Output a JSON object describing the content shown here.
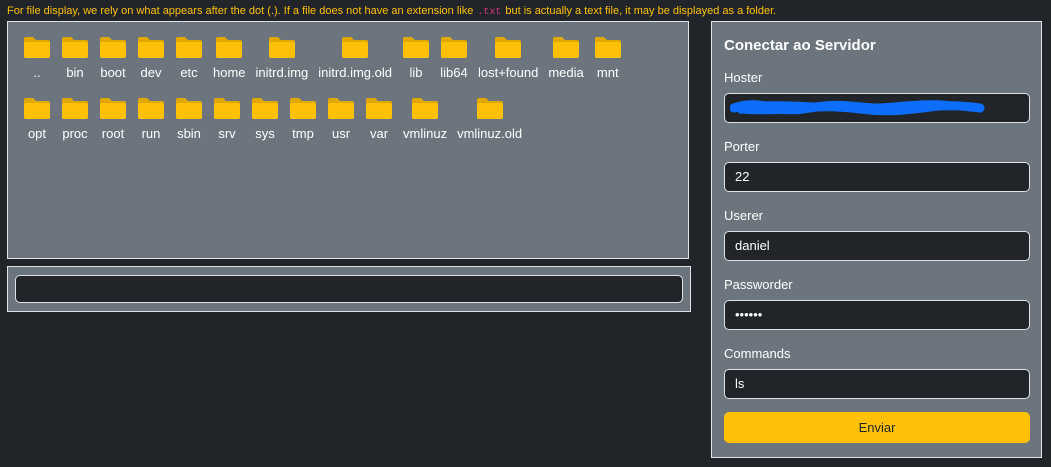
{
  "notice": {
    "before": "For file display, we rely on what appears after the dot (.). If a file does not have an extension like",
    "code": ".txt",
    "after": "but is actually a text file, it may be displayed as a folder."
  },
  "folders": {
    "row1": [
      "..",
      "bin",
      "boot",
      "dev",
      "etc",
      "home",
      "initrd.img",
      "initrd.img.old",
      "lib",
      "lib64",
      "lost+found",
      "media",
      "mnt"
    ],
    "row2": [
      "opt",
      "proc",
      "root",
      "run",
      "sbin",
      "srv",
      "sys",
      "tmp",
      "usr",
      "var",
      "vmlinuz",
      "vmlinuz.old"
    ]
  },
  "command_output": "",
  "server_form": {
    "title": "Conectar ao Servidor",
    "host_label": "Hoster",
    "host_value": "",
    "port_label": "Porter",
    "port_value": "22",
    "user_label": "Userer",
    "user_value": "daniel",
    "password_label": "Passworder",
    "password_value": "••••••",
    "commands_label": "Commands",
    "commands_value": "ls",
    "submit_label": "Enviar"
  },
  "colors": {
    "accent": "#ffc107",
    "panel": "#6c757d",
    "background": "#212529",
    "folder": "#ffc107",
    "code": "#d63384",
    "redaction": "#0d6efd"
  }
}
